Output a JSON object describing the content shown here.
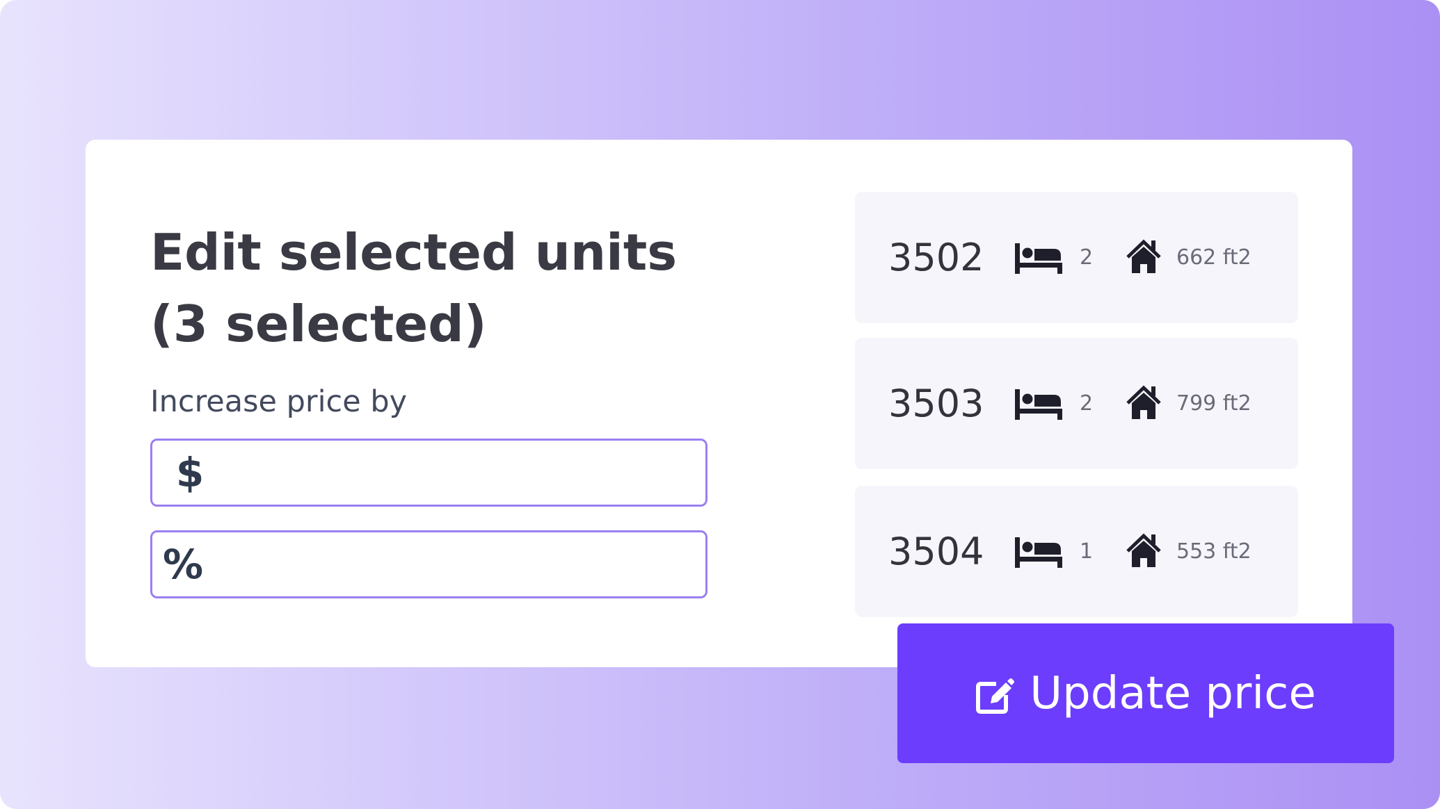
{
  "editor": {
    "title_line1": "Edit selected units",
    "title_line2": "(3 selected)",
    "price_label": "Increase price by",
    "dollar_symbol": "$",
    "percent_symbol": "%",
    "dollar_value": "",
    "percent_value": ""
  },
  "units": [
    {
      "number": "3502",
      "bedrooms": "2",
      "area": "662 ft2",
      "bed_icon": "bed-icon",
      "home_icon": "home-icon"
    },
    {
      "number": "3503",
      "bedrooms": "2",
      "area": "799 ft2",
      "bed_icon": "bed-icon",
      "home_icon": "home-icon"
    },
    {
      "number": "3504",
      "bedrooms": "1",
      "area": "553 ft2",
      "bed_icon": "bed-icon",
      "home_icon": "home-icon"
    }
  ],
  "actions": {
    "update_label": "Update price",
    "update_icon": "edit-icon"
  },
  "colors": {
    "accent": "#6c3dfc",
    "field_border": "#9b7ff0",
    "tile_background": "#f6f5fb"
  }
}
